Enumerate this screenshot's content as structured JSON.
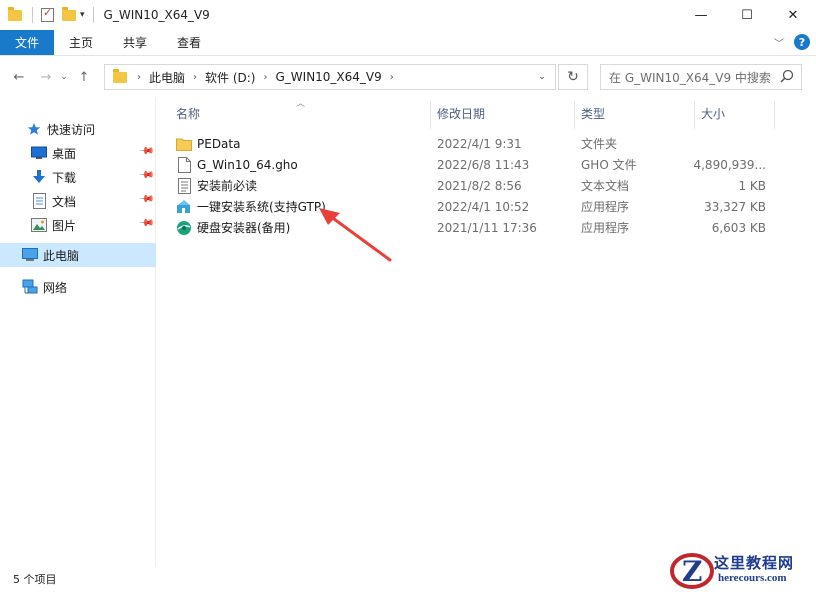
{
  "window": {
    "title": "G_WIN10_X64_V9",
    "minimize_glyph": "—",
    "maximize_glyph": "☐",
    "close_glyph": "✕"
  },
  "ribbon": {
    "tabs": [
      "文件",
      "主页",
      "共享",
      "查看"
    ],
    "help_glyph": "?"
  },
  "address": {
    "crumbs": [
      "此电脑",
      "软件 (D:)",
      "G_WIN10_X64_V9"
    ]
  },
  "search": {
    "placeholder": "在 G_WIN10_X64_V9 中搜索"
  },
  "sidebar": {
    "items": [
      {
        "label": "快速访问",
        "icon": "star-icon",
        "pinned": false
      },
      {
        "label": "桌面",
        "icon": "desktop-icon",
        "pinned": true
      },
      {
        "label": "下载",
        "icon": "download-icon",
        "pinned": true
      },
      {
        "label": "文档",
        "icon": "document-icon",
        "pinned": true
      },
      {
        "label": "图片",
        "icon": "pictures-icon",
        "pinned": true
      },
      {
        "label": "此电脑",
        "icon": "computer-icon",
        "pinned": false,
        "selected": true
      },
      {
        "label": "网络",
        "icon": "network-icon",
        "pinned": false
      }
    ]
  },
  "columns": {
    "name": "名称",
    "date": "修改日期",
    "type": "类型",
    "size": "大小"
  },
  "files": [
    {
      "name": "PEData",
      "date": "2022/4/1 9:31",
      "type": "文件夹",
      "size": "",
      "icon": "folder-icon"
    },
    {
      "name": "G_Win10_64.gho",
      "date": "2022/6/8 11:43",
      "type": "GHO 文件",
      "size": "4,890,939...",
      "icon": "file-icon"
    },
    {
      "name": "安装前必读",
      "date": "2021/8/2 8:56",
      "type": "文本文档",
      "size": "1 KB",
      "icon": "text-file-icon"
    },
    {
      "name": "一键安装系统(支持GTP)",
      "date": "2022/4/1 10:52",
      "type": "应用程序",
      "size": "33,327 KB",
      "icon": "installer-app-icon"
    },
    {
      "name": "硬盘安装器(备用)",
      "date": "2021/1/11 17:36",
      "type": "应用程序",
      "size": "6,603 KB",
      "icon": "disk-installer-icon"
    }
  ],
  "status": {
    "item_count": "5 个项目"
  },
  "watermark": {
    "logo_letter": "Z",
    "title": "这里教程网",
    "url": "herecours.com"
  },
  "colors": {
    "accent": "#1979ca",
    "selected_bg": "#cce8ff",
    "folder": "#f4c542",
    "arrow": "#e8413a",
    "watermark_blue": "#1f3c8f",
    "watermark_red": "#c0282e"
  }
}
